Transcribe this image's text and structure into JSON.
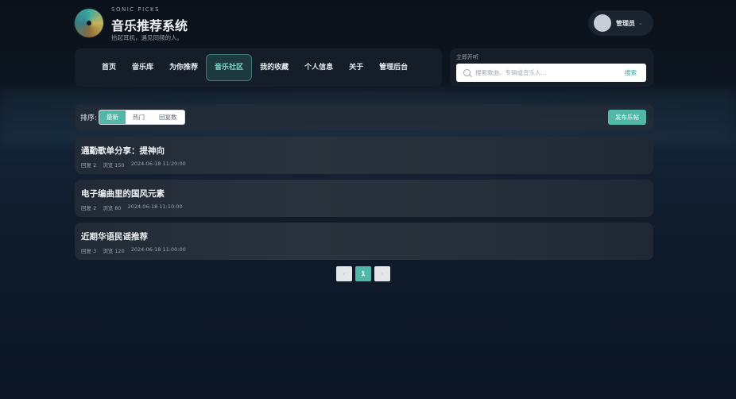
{
  "brand": {
    "subtitle": "SONIC PICKS",
    "title": "音乐推荐系统",
    "tagline": "拾起耳机，遇见同频的人。"
  },
  "user": {
    "name": "管理员"
  },
  "nav": {
    "items": [
      {
        "label": "首页",
        "active": false
      },
      {
        "label": "音乐库",
        "active": false
      },
      {
        "label": "为你推荐",
        "active": false
      },
      {
        "label": "音乐社区",
        "active": true
      },
      {
        "label": "我的收藏",
        "active": false
      },
      {
        "label": "个人信息",
        "active": false
      },
      {
        "label": "关于",
        "active": false
      },
      {
        "label": "管理后台",
        "active": false
      }
    ]
  },
  "search": {
    "label": "立即开听",
    "placeholder": "搜索歌曲、专辑或音乐人…",
    "button": "搜索"
  },
  "sort": {
    "label": "排序:",
    "options": [
      {
        "label": "最新",
        "active": true
      },
      {
        "label": "热门",
        "active": false
      },
      {
        "label": "回复数",
        "active": false
      }
    ],
    "publish_button": "发布乐帖"
  },
  "posts": [
    {
      "title": "通勤歌单分享：提神向",
      "replies": "回复 2",
      "views": "浏览 150",
      "time": "2024-06-18 11:20:00"
    },
    {
      "title": "电子编曲里的国风元素",
      "replies": "回复 2",
      "views": "浏览 80",
      "time": "2024-06-18 11:10:00"
    },
    {
      "title": "近期华语民谣推荐",
      "replies": "回复 3",
      "views": "浏览 120",
      "time": "2024-06-18 11:00:00"
    }
  ],
  "pagination": {
    "prev": "‹",
    "current": "1",
    "next": "›"
  },
  "colors": {
    "accent": "#52b7a7",
    "active_nav_text": "#7fd8cc"
  }
}
